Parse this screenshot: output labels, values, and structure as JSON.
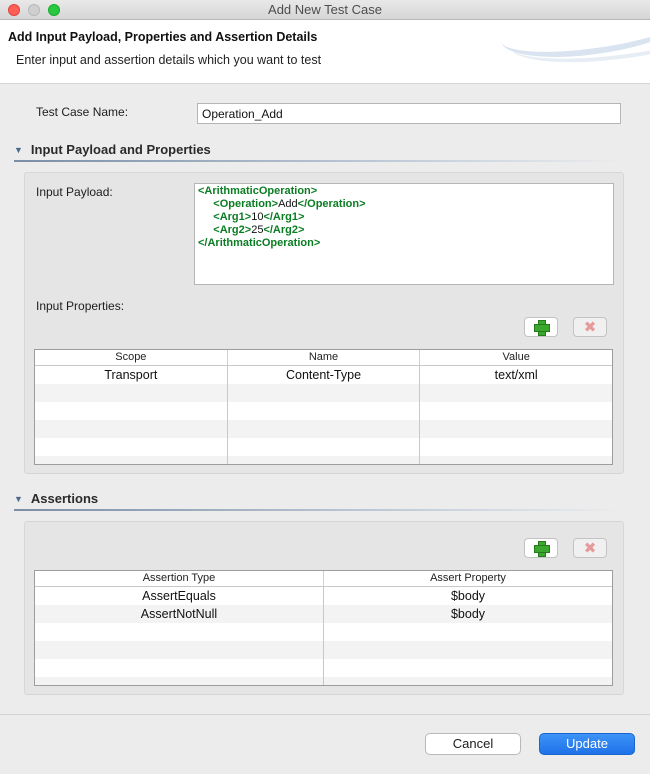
{
  "window": {
    "title": "Add New Test Case"
  },
  "header": {
    "title": "Add Input Payload, Properties and Assertion Details",
    "description": "Enter input and assertion details which you want to test"
  },
  "test_case": {
    "label": "Test Case Name:",
    "value": "Operation_Add"
  },
  "section_input": {
    "title": "Input Payload and Properties",
    "payload_label": "Input Payload:",
    "payload": {
      "l1": "<ArithmaticOperation>",
      "op_open": "<Operation>",
      "op_val": "Add",
      "op_close": "</Operation>",
      "a1_open": "<Arg1>",
      "a1_val": "10",
      "a1_close": "</Arg1>",
      "a2_open": "<Arg2>",
      "a2_val": "25",
      "a2_close": "</Arg2>",
      "l5": "</ArithmaticOperation>"
    },
    "properties_label": "Input Properties:",
    "table": {
      "headers": [
        "Scope",
        "Name",
        "Value"
      ],
      "rows": [
        [
          "Transport",
          "Content-Type",
          "text/xml"
        ]
      ]
    }
  },
  "section_assert": {
    "title": "Assertions",
    "table": {
      "headers": [
        "Assertion Type",
        "Assert Property"
      ],
      "rows": [
        [
          "AssertEquals",
          "$body"
        ],
        [
          "AssertNotNull",
          "$body"
        ]
      ]
    }
  },
  "buttons": {
    "cancel": "Cancel",
    "update": "Update"
  },
  "icons": {
    "add": "plus-icon",
    "remove": "x-icon"
  },
  "colors": {
    "xml_tag": "#0a7d22",
    "primary": "#1e72e8",
    "close": "#fe5f57",
    "maximize": "#28c840"
  }
}
